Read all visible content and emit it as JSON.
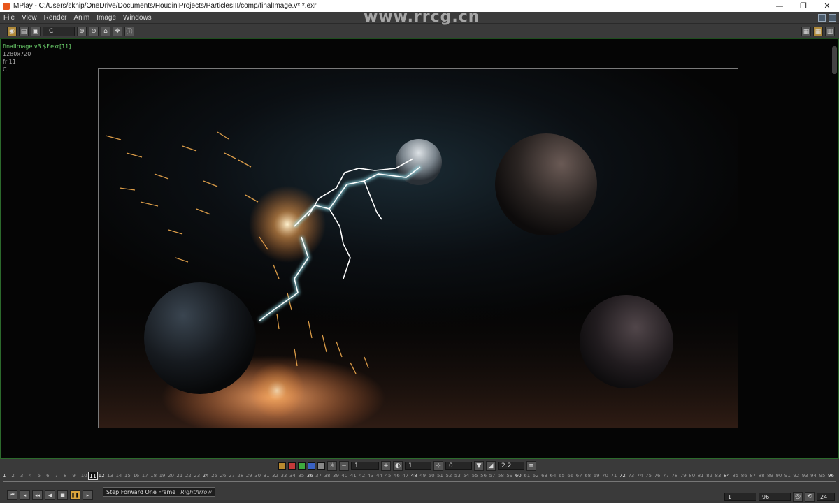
{
  "window": {
    "title": "MPlay - C:/Users/sknip/OneDrive/Documents/HoudiniProjects/ParticlesIII/comp/finalImage.v*.*.exr",
    "minimize_label": "—",
    "restore_label": "❐",
    "close_label": "✕"
  },
  "menu": [
    "File",
    "View",
    "Render",
    "Anim",
    "Image",
    "Windows"
  ],
  "toolbar": {
    "channel": "C"
  },
  "viewer": {
    "filename": "finalImage.v3.$F.exr[11]",
    "resolution": "1280x720",
    "frame": "fr 11",
    "channel": "C"
  },
  "watermark": "www.rrcg.cn",
  "image_controls": {
    "exposure_value": "1",
    "gamma_like_value": "1",
    "offset_value": "0",
    "gamma_value": "2.2",
    "colors": {
      "swatch1": "#b8892f",
      "swatch2": "#c43a3a",
      "swatch3": "#3eaa3e",
      "swatch4": "#3a62c4",
      "swatch5": "#888888"
    }
  },
  "timeline": {
    "current_frame": "11",
    "start": 1,
    "end": 96,
    "major_ticks": [
      1,
      12,
      24,
      36,
      48,
      60,
      72,
      84,
      96
    ]
  },
  "tooltip": {
    "text": "Step Forward One Frame",
    "shortcut": "RightArrow"
  },
  "frame_field": "11",
  "range": {
    "start": "1",
    "end": "96",
    "fps": "24"
  }
}
